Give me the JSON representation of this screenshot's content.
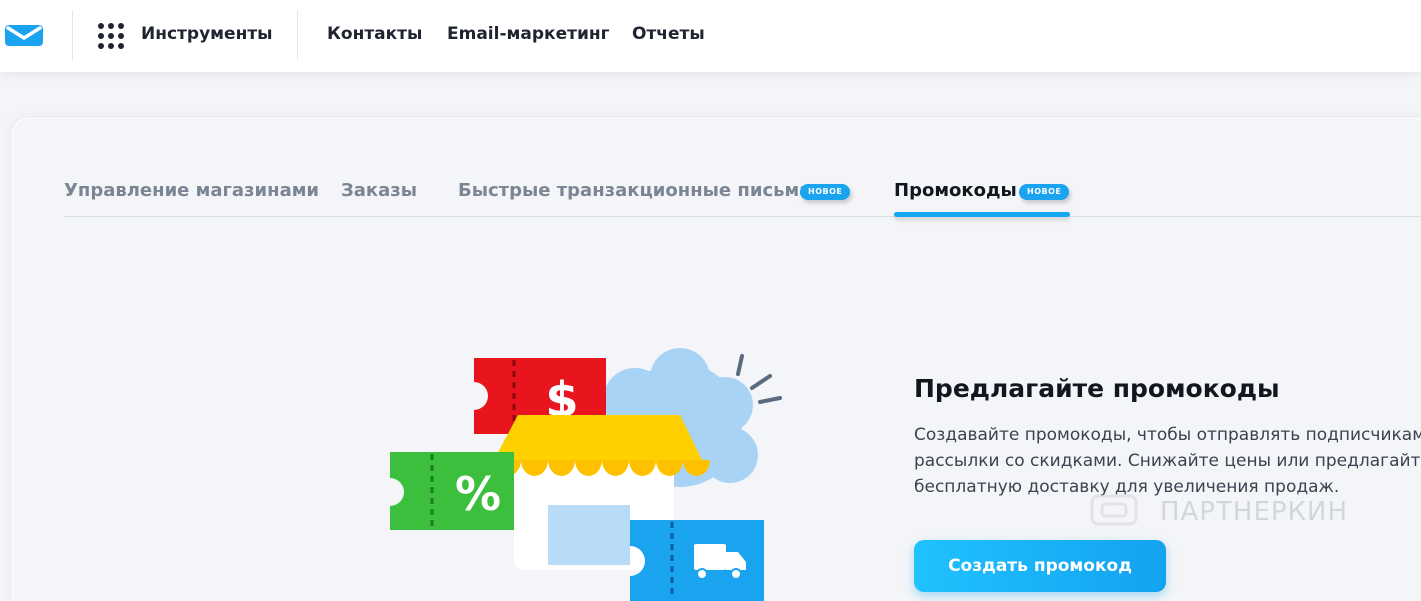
{
  "topbar": {
    "tools_label": "Инструменты",
    "nav": [
      "Контакты",
      "Email-маркетинг",
      "Отчеты"
    ]
  },
  "tabs": [
    {
      "label": "Управление магазинами",
      "active": false
    },
    {
      "label": "Заказы",
      "active": false
    },
    {
      "label": "Быстрые транзакционные письма",
      "badge": "НОВОЕ",
      "active": false
    },
    {
      "label": "Промокоды",
      "badge": "НОВОЕ",
      "active": true
    }
  ],
  "promo": {
    "title": "Предлагайте промокоды",
    "description": "Создавайте промокоды, чтобы отправлять подписчикам рассылки со скидками. Снижайте цены или предлагайте бесплатную доставку для увеличения продаж.",
    "cta_label": "Создать промокод"
  },
  "watermark": "ПАРТНЕРКИН",
  "colors": {
    "accent": "#15a8f2",
    "coupon_red": "#e8141e",
    "coupon_green": "#3cbf3c",
    "coupon_blue": "#1aa3ee",
    "awning_yellow": "#ffd000"
  }
}
